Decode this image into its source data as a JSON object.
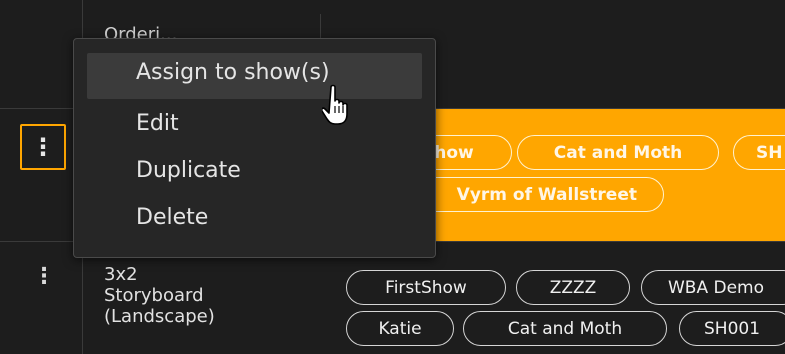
{
  "header": {
    "first_col_label": "Orderi..."
  },
  "context_menu": {
    "items": [
      {
        "label": "Assign to show(s)"
      },
      {
        "label": "Edit"
      },
      {
        "label": "Duplicate"
      },
      {
        "label": "Delete"
      }
    ]
  },
  "selected_row": {
    "chips_row1": [
      "how",
      "Cat and Moth",
      "SH"
    ],
    "chips_row2": [
      "Vyrm of Wallstreet"
    ]
  },
  "storyboard_row": {
    "title_lines": [
      "3x2",
      "Storyboard",
      "(Landscape)"
    ],
    "chips_row1": [
      "FirstShow",
      "ZZZZ",
      "WBA Demo"
    ],
    "chips_row2": [
      "Katie",
      "Cat and Moth",
      "SH001"
    ]
  },
  "colors": {
    "accent": "#ffa600",
    "background": "#1d1d1d"
  },
  "icons": [
    "kebab-menu-icon",
    "hand-pointer-cursor-icon"
  ]
}
